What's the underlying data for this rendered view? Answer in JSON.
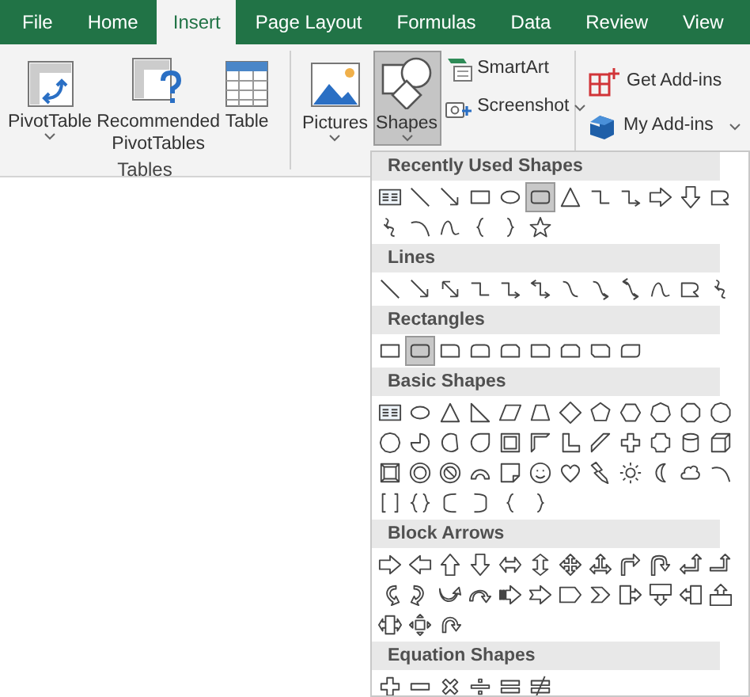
{
  "tabs": [
    {
      "label": "File",
      "selected": false
    },
    {
      "label": "Home",
      "selected": false
    },
    {
      "label": "Insert",
      "selected": true
    },
    {
      "label": "Page Layout",
      "selected": false
    },
    {
      "label": "Formulas",
      "selected": false
    },
    {
      "label": "Data",
      "selected": false
    },
    {
      "label": "Review",
      "selected": false
    },
    {
      "label": "View",
      "selected": false
    }
  ],
  "ribbon": {
    "tables": {
      "label": "Tables",
      "buttons": [
        {
          "kind": "pivot",
          "label": "PivotTable",
          "dropdown": true
        },
        {
          "kind": "recommended",
          "label": "Recommended PivotTables",
          "dropdown": false
        },
        {
          "kind": "table",
          "label": "Table",
          "dropdown": false
        }
      ]
    },
    "illustrations": {
      "large": [
        {
          "kind": "pictures",
          "label": "Pictures",
          "dropdown": true,
          "selected": false
        },
        {
          "kind": "shapes",
          "label": "Shapes",
          "dropdown": true,
          "selected": true
        }
      ],
      "small": [
        {
          "kind": "smartart",
          "label": "SmartArt",
          "dropdown": false
        },
        {
          "kind": "screenshot",
          "label": "Screenshot",
          "dropdown": true
        }
      ]
    },
    "addins": [
      {
        "kind": "get",
        "label": "Get Add-ins",
        "dropdown": false
      },
      {
        "kind": "my",
        "label": "My Add-ins",
        "dropdown": true
      }
    ]
  },
  "gallery": {
    "sections": [
      {
        "title": "Recently Used Shapes",
        "shapes": [
          {
            "kind": "text-box",
            "selected": false
          },
          {
            "kind": "line",
            "selected": false
          },
          {
            "kind": "arrow",
            "selected": false
          },
          {
            "kind": "rectangle",
            "selected": false
          },
          {
            "kind": "oval",
            "selected": false
          },
          {
            "kind": "rounded-rectangle",
            "selected": true
          },
          {
            "kind": "triangle",
            "selected": false
          },
          {
            "kind": "elbow-connector",
            "selected": false
          },
          {
            "kind": "elbow-arrow",
            "selected": false
          },
          {
            "kind": "right-arrow",
            "selected": false
          },
          {
            "kind": "down-arrow",
            "selected": false
          },
          {
            "kind": "freeform",
            "selected": false
          },
          {
            "kind": "scribble",
            "selected": false
          },
          {
            "kind": "arc",
            "selected": false
          },
          {
            "kind": "curve",
            "selected": false
          },
          {
            "kind": "left-brace",
            "selected": false
          },
          {
            "kind": "right-brace",
            "selected": false
          },
          {
            "kind": "star",
            "selected": false
          }
        ]
      },
      {
        "title": "Lines",
        "shapes": [
          {
            "kind": "line",
            "selected": false
          },
          {
            "kind": "arrow",
            "selected": false
          },
          {
            "kind": "double-arrow",
            "selected": false
          },
          {
            "kind": "elbow-connector",
            "selected": false
          },
          {
            "kind": "elbow-arrow",
            "selected": false
          },
          {
            "kind": "elbow-double-arrow",
            "selected": false
          },
          {
            "kind": "curved-connector",
            "selected": false
          },
          {
            "kind": "curved-arrow",
            "selected": false
          },
          {
            "kind": "curved-double-arrow",
            "selected": false
          },
          {
            "kind": "curve",
            "selected": false
          },
          {
            "kind": "freeform",
            "selected": false
          },
          {
            "kind": "scribble",
            "selected": false
          }
        ]
      },
      {
        "title": "Rectangles",
        "shapes": [
          {
            "kind": "rectangle",
            "selected": false
          },
          {
            "kind": "rounded-rectangle",
            "selected": true
          },
          {
            "kind": "round-corner-rectangle",
            "selected": false
          },
          {
            "kind": "round-same-side-rectangle",
            "selected": false
          },
          {
            "kind": "snip-round-rectangle",
            "selected": false
          },
          {
            "kind": "snip-corner-rectangle",
            "selected": false
          },
          {
            "kind": "snip-same-side-rectangle",
            "selected": false
          },
          {
            "kind": "snip-diagonal-rectangle",
            "selected": false
          },
          {
            "kind": "round-diagonal-rectangle",
            "selected": false
          }
        ]
      },
      {
        "title": "Basic Shapes",
        "shapes": [
          {
            "kind": "text-box",
            "selected": false
          },
          {
            "kind": "oval",
            "selected": false
          },
          {
            "kind": "triangle",
            "selected": false
          },
          {
            "kind": "right-triangle",
            "selected": false
          },
          {
            "kind": "parallelogram",
            "selected": false
          },
          {
            "kind": "trapezoid",
            "selected": false
          },
          {
            "kind": "diamond",
            "selected": false
          },
          {
            "kind": "pentagon",
            "selected": false
          },
          {
            "kind": "hexagon",
            "selected": false
          },
          {
            "kind": "heptagon",
            "selected": false
          },
          {
            "kind": "octagon",
            "selected": false
          },
          {
            "kind": "decagon",
            "selected": false
          },
          {
            "kind": "dodecagon",
            "selected": false
          },
          {
            "kind": "pie",
            "selected": false
          },
          {
            "kind": "chord",
            "selected": false
          },
          {
            "kind": "teardrop",
            "selected": false
          },
          {
            "kind": "frame",
            "selected": false
          },
          {
            "kind": "half-frame",
            "selected": false
          },
          {
            "kind": "l-shape",
            "selected": false
          },
          {
            "kind": "diagonal-stripe",
            "selected": false
          },
          {
            "kind": "cross",
            "selected": false
          },
          {
            "kind": "plaque",
            "selected": false
          },
          {
            "kind": "can",
            "selected": false
          },
          {
            "kind": "cube",
            "selected": false
          },
          {
            "kind": "bevel",
            "selected": false
          },
          {
            "kind": "donut",
            "selected": false
          },
          {
            "kind": "no-symbol",
            "selected": false
          },
          {
            "kind": "block-arc",
            "selected": false
          },
          {
            "kind": "folded-corner",
            "selected": false
          },
          {
            "kind": "smiley",
            "selected": false
          },
          {
            "kind": "heart",
            "selected": false
          },
          {
            "kind": "lightning",
            "selected": false
          },
          {
            "kind": "sun",
            "selected": false
          },
          {
            "kind": "moon",
            "selected": false
          },
          {
            "kind": "cloud",
            "selected": false
          },
          {
            "kind": "arc",
            "selected": false
          },
          {
            "kind": "double-bracket",
            "selected": false
          },
          {
            "kind": "double-brace",
            "selected": false
          },
          {
            "kind": "left-bracket",
            "selected": false
          },
          {
            "kind": "right-bracket",
            "selected": false
          },
          {
            "kind": "left-brace",
            "selected": false
          },
          {
            "kind": "right-brace",
            "selected": false
          }
        ]
      },
      {
        "title": "Block Arrows",
        "shapes": [
          {
            "kind": "right-arrow",
            "selected": false
          },
          {
            "kind": "left-arrow",
            "selected": false
          },
          {
            "kind": "up-arrow",
            "selected": false
          },
          {
            "kind": "down-arrow",
            "selected": false
          },
          {
            "kind": "left-right-arrow",
            "selected": false
          },
          {
            "kind": "up-down-arrow",
            "selected": false
          },
          {
            "kind": "quad-arrow",
            "selected": false
          },
          {
            "kind": "left-right-up-arrow",
            "selected": false
          },
          {
            "kind": "bent-arrow",
            "selected": false
          },
          {
            "kind": "u-turn-arrow",
            "selected": false
          },
          {
            "kind": "left-up-arrow",
            "selected": false
          },
          {
            "kind": "bent-up-arrow",
            "selected": false
          },
          {
            "kind": "curved-right-arrow",
            "selected": false
          },
          {
            "kind": "curved-left-arrow",
            "selected": false
          },
          {
            "kind": "curved-up-arrow",
            "selected": false
          },
          {
            "kind": "curved-down-arrow",
            "selected": false
          },
          {
            "kind": "striped-right-arrow",
            "selected": false
          },
          {
            "kind": "notched-right-arrow",
            "selected": false
          },
          {
            "kind": "pentagon-arrow",
            "selected": false
          },
          {
            "kind": "chevron",
            "selected": false
          },
          {
            "kind": "right-arrow-callout",
            "selected": false
          },
          {
            "kind": "down-arrow-callout",
            "selected": false
          },
          {
            "kind": "left-arrow-callout",
            "selected": false
          },
          {
            "kind": "up-arrow-callout",
            "selected": false
          },
          {
            "kind": "left-right-arrow-callout",
            "selected": false
          },
          {
            "kind": "quad-arrow-callout",
            "selected": false
          },
          {
            "kind": "circular-arrow",
            "selected": false
          }
        ]
      },
      {
        "title": "Equation Shapes",
        "shapes": [
          {
            "kind": "plus",
            "selected": false
          },
          {
            "kind": "minus",
            "selected": false
          },
          {
            "kind": "multiply",
            "selected": false
          },
          {
            "kind": "divide",
            "selected": false
          },
          {
            "kind": "equal",
            "selected": false
          },
          {
            "kind": "not-equal",
            "selected": false
          }
        ]
      }
    ]
  }
}
